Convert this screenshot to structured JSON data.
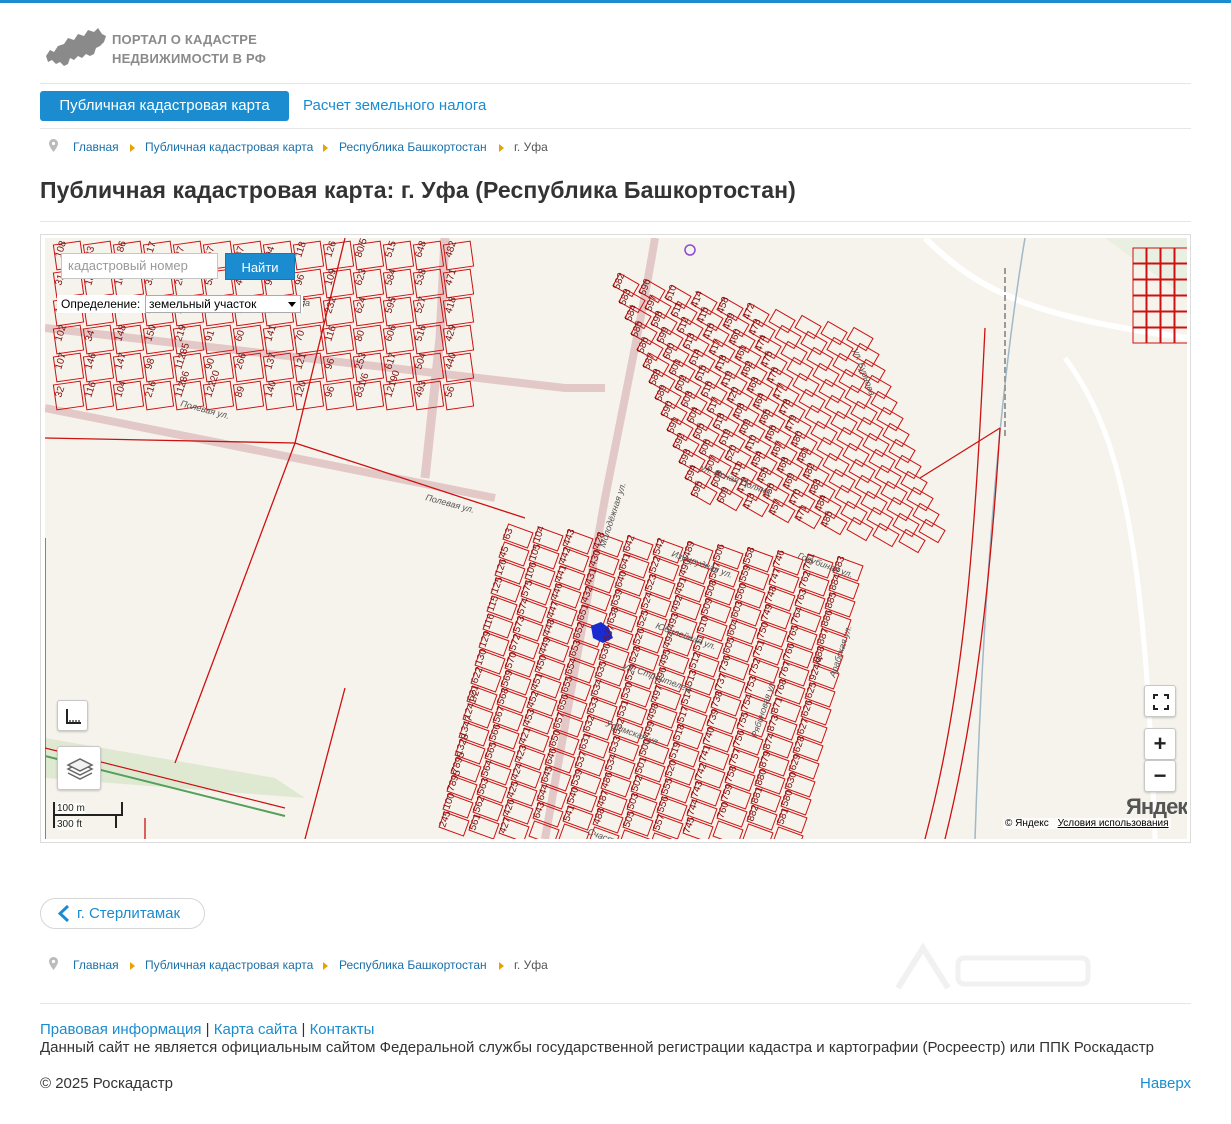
{
  "site": {
    "logo_line1": "ПОРТАЛ О КАДАСТРЕ",
    "logo_line2": "НЕДВИЖИМОСТИ В РФ",
    "accent_color": "#1a8ccf"
  },
  "nav": {
    "active": "Публичная кадастровая карта",
    "link": "Расчет земельного налога"
  },
  "breadcrumbs": [
    "Главная",
    "Публичная кадастровая карта",
    "Республика Башкортостан",
    "г. Уфа"
  ],
  "page": {
    "title": "Публичная кадастровая карта: г. Уфа (Республика Башкортостан)"
  },
  "map": {
    "search_placeholder": "кадастровый номер",
    "search_button": "Найти",
    "definition_label": "Определение:",
    "definition_value": "земельный участок",
    "zoom_in": "+",
    "zoom_out": "−",
    "scale_metric": "100 m",
    "scale_imperial": "300 ft",
    "provider_logo": "Яндекс",
    "copyright": "© Яндекс",
    "terms": "Условия использования",
    "streets": [
      "ул. Мира",
      "Полевая ул.",
      "Полевая ул.",
      "ул. Бурнова",
      "ул. Ясная Поляна",
      "Изумрудная ул.",
      "Юбилейная ул.",
      "ул. Строителей",
      "Уфимская ул.",
      "Счастливая ул.",
      "Молодёжная ул.",
      "Рябиновая ул.",
      "Арабская ул.",
      "Голубиная ул."
    ],
    "parcel_labels": [
      "108",
      "31",
      "123",
      "102",
      "107",
      "32",
      "33",
      "185",
      "106",
      "34",
      "146",
      "116",
      "186",
      "105",
      "36",
      "148",
      "147",
      "104",
      "117",
      "39",
      "40",
      "150",
      "98",
      "216",
      "27",
      "26",
      "218",
      "219",
      "11285",
      "11286",
      "57",
      "58",
      "56",
      "91",
      "90",
      "12220",
      "87",
      "47",
      "114",
      "60",
      "266",
      "89",
      "94",
      "93",
      "85",
      "141",
      "137",
      "140",
      "118",
      "96",
      "136",
      "70",
      "121",
      "120",
      "126",
      "109",
      "232",
      "116",
      "96",
      "96",
      "80/5",
      "623",
      "624",
      "80",
      "253",
      "831/6",
      "515",
      "584",
      "595",
      "606",
      "617",
      "12190",
      "648",
      "538",
      "527",
      "516",
      "504",
      "493",
      "482",
      "471",
      "418",
      "429",
      "440",
      "56",
      "63",
      "45",
      "126",
      "125",
      "115",
      "116",
      "129",
      "130",
      "622",
      "621",
      "1241/2",
      "1347",
      "1328",
      "7895",
      "7895",
      "100",
      "245",
      "104",
      "105",
      "106",
      "575",
      "574",
      "573",
      "572",
      "570",
      "569",
      "568",
      "567",
      "566",
      "565",
      "564",
      "563",
      "562",
      "561",
      "443",
      "442",
      "441",
      "446",
      "447",
      "448",
      "449",
      "450",
      "451",
      "452",
      "453",
      "421",
      "423",
      "424",
      "425",
      "426",
      "427",
      "428",
      "430",
      "431",
      "432",
      "651",
      "652",
      "653",
      "654",
      "655",
      "656",
      "657",
      "650",
      "646",
      "645",
      "644",
      "643",
      "642",
      "641",
      "640",
      "639",
      "638",
      "637",
      "636",
      "635",
      "634",
      "633",
      "632",
      "631",
      "537",
      "539",
      "540",
      "541",
      "542",
      "522",
      "523",
      "524",
      "525",
      "526",
      "528",
      "529",
      "530",
      "531",
      "532",
      "533",
      "534",
      "486",
      "487",
      "488",
      "489",
      "490",
      "491",
      "492",
      "493",
      "494",
      "495",
      "496",
      "497",
      "498",
      "499",
      "500",
      "501",
      "502",
      "503",
      "505",
      "506",
      "507",
      "508",
      "509",
      "510",
      "511",
      "512",
      "513",
      "514",
      "517",
      "518",
      "519",
      "520",
      "555",
      "556",
      "557",
      "558",
      "559",
      "560",
      "603",
      "604",
      "605",
      "736",
      "737",
      "738",
      "739",
      "740",
      "741",
      "742",
      "743",
      "744",
      "745",
      "746",
      "747",
      "748",
      "749",
      "750",
      "751",
      "752",
      "753",
      "754",
      "755",
      "756",
      "757",
      "758",
      "759",
      "760",
      "761",
      "762",
      "763",
      "764",
      "765",
      "766",
      "767",
      "768",
      "871",
      "873",
      "874",
      "879",
      "880",
      "881",
      "882",
      "883",
      "884",
      "885",
      "886",
      "887",
      "888",
      "924/4",
      "625",
      "626",
      "627",
      "628",
      "629",
      "630",
      "580",
      "581",
      "582",
      "583",
      "584",
      "585",
      "586",
      "587",
      "588",
      "589",
      "590",
      "591",
      "592",
      "593",
      "594",
      "595",
      "596",
      "597",
      "598",
      "599",
      "600",
      "601",
      "602",
      "603",
      "604",
      "605",
      "606",
      "607",
      "608",
      "609",
      "610",
      "611",
      "612",
      "613",
      "614",
      "615",
      "616",
      "617",
      "618",
      "619",
      "620",
      "411",
      "412",
      "413",
      "414",
      "415",
      "416",
      "417",
      "418",
      "419",
      "420",
      "408",
      "409",
      "410",
      "454",
      "455",
      "456",
      "457",
      "458",
      "459",
      "460",
      "461",
      "462",
      "463",
      "464",
      "465",
      "466",
      "467",
      "468",
      "469",
      "470",
      "471",
      "472",
      "473",
      "474",
      "475",
      "476",
      "477",
      "478",
      "479",
      "480",
      "481",
      "482",
      "483",
      "484",
      "485"
    ]
  },
  "back_link": "г. Стерлитамак",
  "footer": {
    "links": [
      "Правовая информация",
      "Карта сайта",
      "Контакты"
    ],
    "disclaimer": "Данный сайт не является официальным сайтом Федеральной службы государственной регистрации кадастра и картографии (Росреестр) или ППК Роскадастр",
    "copyright": "© 2025 Роскадастр",
    "to_top": "Наверх"
  },
  "colors": {
    "parcel_border": "#cc1111",
    "parcel_label": "#7a1010",
    "map_background": "#f6f3ec",
    "breadcrumb_arrow": "#e8a200"
  }
}
